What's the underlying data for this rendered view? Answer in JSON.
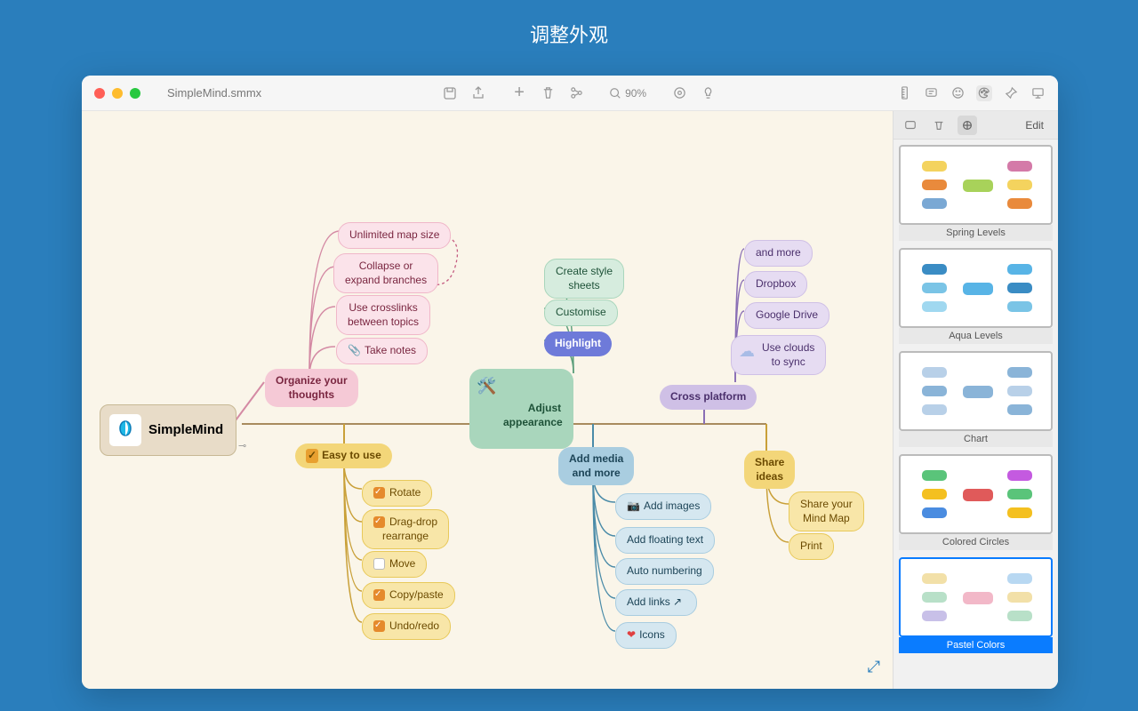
{
  "page_title": "调整外观",
  "filename": "SimpleMind.smmx",
  "zoom": "90%",
  "edit_label": "Edit",
  "root": "SimpleMind",
  "nodes": {
    "organize": "Organize your\nthoughts",
    "org1": "Unlimited map size",
    "org2": "Collapse or\nexpand branches",
    "org3": "Use crosslinks\nbetween topics",
    "org4": "Take notes",
    "easy": "Easy to use",
    "e1": "Rotate",
    "e2": "Drag-drop\nrearrange",
    "e3": "Move",
    "e4": "Copy/paste",
    "e5": "Undo/redo",
    "adjust": "Adjust\nappearance",
    "a1": "Create style\nsheets",
    "a2": "Customise",
    "a3": "Highlight",
    "addmedia": "Add media\nand more",
    "m1": "Add images",
    "m2": "Add floating text",
    "m3": "Auto numbering",
    "m4": "Add links",
    "m5": "Icons",
    "cross": "Cross platform",
    "c1": "and more",
    "c2": "Dropbox",
    "c3": "Google Drive",
    "c4": "Use clouds\nto sync",
    "share": "Share\nideas",
    "s1": "Share your\nMind Map",
    "s2": "Print"
  },
  "themes": [
    {
      "label": "Spring Levels",
      "selected": false
    },
    {
      "label": "Aqua Levels",
      "selected": false
    },
    {
      "label": "Chart",
      "selected": false
    },
    {
      "label": "Colored Circles",
      "selected": false
    },
    {
      "label": "Pastel Colors",
      "selected": true
    }
  ]
}
